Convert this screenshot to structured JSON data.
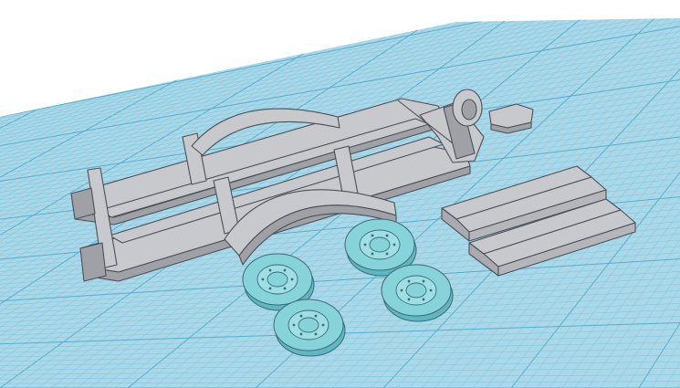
{
  "viewport": {
    "background": "#ffffff",
    "workplane_color": "#aad8e8",
    "grid_minor_color": "#7fc4dc",
    "grid_major_color": "#56aecf"
  },
  "objects": {
    "trailer_frame": {
      "name": "trailer-frame",
      "color": "#c8c9cc"
    },
    "fenders": {
      "name": "fenders",
      "color": "#c8c9cc"
    },
    "winch": {
      "name": "winch",
      "color": "#c8c9cc"
    },
    "ramps": {
      "name": "ramps",
      "color": "#c8c9cc",
      "count": 2
    },
    "wheels": {
      "name": "wheels",
      "color": "#86d3da",
      "count": 4
    }
  }
}
